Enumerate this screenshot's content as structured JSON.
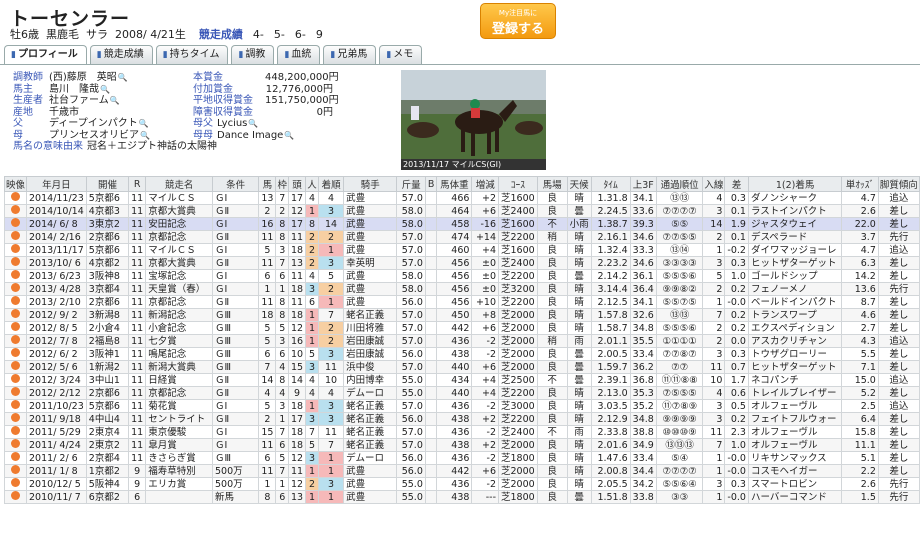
{
  "horse": {
    "name": "トーセンラー",
    "sex_age": "牡6歳",
    "coat": "黒鹿毛",
    "breed": "サラ",
    "birth": "2008/ 4/21生",
    "perf_label": "競走成績",
    "perf": [
      "4-",
      "5-",
      "6-",
      "9"
    ]
  },
  "register_button": {
    "small": "My注目馬に",
    "big": "登録する"
  },
  "tabs": [
    {
      "label": "プロフィール"
    },
    {
      "label": "競走成績"
    },
    {
      "label": "持ちタイム"
    },
    {
      "label": "調教"
    },
    {
      "label": "血統"
    },
    {
      "label": "兄弟馬"
    },
    {
      "label": "メモ"
    }
  ],
  "profile": {
    "left": [
      {
        "label": "調教師",
        "value": "(西)藤原　英昭"
      },
      {
        "label": "馬主",
        "value": "島川　隆哉"
      },
      {
        "label": "生産者",
        "value": "社台ファーム"
      },
      {
        "label": "産地",
        "value": "千歳市"
      },
      {
        "label": "父",
        "value": "ディープインパクト"
      },
      {
        "label": "母",
        "value": "プリンセスオリビア"
      },
      {
        "label": "馬名の意味由来",
        "value": "冠名＋エジプト神話の太陽神"
      }
    ],
    "right": [
      {
        "label": "本賞金",
        "value": "448,200,000円"
      },
      {
        "label": "付加賞金",
        "value": "12,776,000円"
      },
      {
        "label": "平地収得賞金",
        "value": "151,750,000円"
      },
      {
        "label": "障害収得賞金",
        "value": "0円"
      },
      {
        "label": "母父",
        "value": "Lycius"
      },
      {
        "label": "母母",
        "value": "Dance Image"
      }
    ]
  },
  "photo_caption": "2013/11/17 マイルCS(GⅠ)",
  "table": {
    "headers": [
      "映像",
      "年月日",
      "開催",
      "R",
      "競走名",
      "条件",
      "馬",
      "枠",
      "頭",
      "人",
      "着順",
      "騎手",
      "斤量",
      "B",
      "馬体重",
      "増減",
      "ｺｰｽ",
      "馬場",
      "天候",
      "ﾀｲﾑ",
      "上3F",
      "通過順位",
      "入線",
      "差",
      "1(2)着馬",
      "単ｵｯｽﾞ",
      "脚質傾向"
    ],
    "rows": [
      [
        "",
        "2014/11/23",
        "5京都6",
        "11",
        "マイルＣＳ",
        "ＧⅠ",
        "13",
        "7",
        "17",
        "4",
        "4",
        "武豊",
        "57.0",
        "",
        "466",
        "+2",
        "芝1600",
        "良",
        "晴",
        "1.31.8",
        "34.1",
        "⑬⑬",
        "4",
        "0.3",
        "ダノンシャーク",
        "4.7",
        "追込"
      ],
      [
        "",
        "2014/10/14",
        "4京都3",
        "11",
        "京都大賞典",
        "ＧⅡ",
        "2",
        "2",
        "12",
        "1",
        "3",
        "武豊",
        "58.0",
        "",
        "464",
        "+6",
        "芝2400",
        "良",
        "曇",
        "2.24.5",
        "33.6",
        "⑦⑦⑦⑦",
        "3",
        "0.1",
        "ラストインパクト",
        "2.6",
        "差し"
      ],
      [
        "",
        "2014/ 6/ 8",
        "3東京2",
        "11",
        "安田記念",
        "ＧⅠ",
        "16",
        "8",
        "17",
        "8",
        "14",
        "武豊",
        "58.0",
        "",
        "458",
        "-16",
        "芝1600",
        "不",
        "小雨",
        "1.38.7",
        "39.3",
        "⑤⑤",
        "14",
        "1.9",
        "ジャスタウェイ",
        "22.0",
        "差し"
      ],
      [
        "",
        "2014/ 2/16",
        "2京都6",
        "11",
        "京都記念",
        "ＧⅡ",
        "11",
        "8",
        "11",
        "2",
        "2",
        "武豊",
        "57.0",
        "",
        "474",
        "+14",
        "芝2200",
        "稍",
        "晴",
        "2.16.1",
        "34.6",
        "⑦⑦⑤⑤",
        "2",
        "0.1",
        "デスペラード",
        "3.7",
        "先行"
      ],
      [
        "",
        "2013/11/17",
        "5京都6",
        "11",
        "マイルＣＳ",
        "ＧⅠ",
        "5",
        "3",
        "18",
        "2",
        "1",
        "武豊",
        "57.0",
        "",
        "460",
        "+4",
        "芝1600",
        "良",
        "晴",
        "1.32.4",
        "33.3",
        "⑬⑭",
        "1",
        "-0.2",
        "ダイワマッジョーレ",
        "4.7",
        "追込"
      ],
      [
        "",
        "2013/10/ 6",
        "4京都2",
        "11",
        "京都大賞典",
        "ＧⅡ",
        "11",
        "7",
        "13",
        "2",
        "3",
        "幸英明",
        "57.0",
        "",
        "456",
        "±0",
        "芝2400",
        "良",
        "晴",
        "2.23.2",
        "34.6",
        "③③③③",
        "3",
        "0.3",
        "ヒットザターゲット",
        "6.3",
        "差し"
      ],
      [
        "",
        "2013/ 6/23",
        "3阪神8",
        "11",
        "宝塚記念",
        "ＧⅠ",
        "6",
        "6",
        "11",
        "4",
        "5",
        "武豊",
        "58.0",
        "",
        "456",
        "±0",
        "芝2200",
        "良",
        "曇",
        "2.14.2",
        "36.1",
        "⑤⑤⑤⑥",
        "5",
        "1.0",
        "ゴールドシップ",
        "14.2",
        "差し"
      ],
      [
        "",
        "2013/ 4/28",
        "3京都4",
        "11",
        "天皇賞（春）",
        "ＧⅠ",
        "1",
        "1",
        "18",
        "3",
        "2",
        "武豊",
        "58.0",
        "",
        "456",
        "±0",
        "芝3200",
        "良",
        "晴",
        "3.14.4",
        "36.4",
        "⑨⑨⑧②",
        "2",
        "0.2",
        "フェノーメノ",
        "13.6",
        "先行"
      ],
      [
        "",
        "2013/ 2/10",
        "2京都6",
        "11",
        "京都記念",
        "ＧⅡ",
        "11",
        "8",
        "11",
        "6",
        "1",
        "武豊",
        "56.0",
        "",
        "456",
        "+10",
        "芝2200",
        "良",
        "晴",
        "2.12.5",
        "34.1",
        "⑤⑤⑦⑤",
        "1",
        "-0.0",
        "ベールドインパクト",
        "8.7",
        "差し"
      ],
      [
        "",
        "2012/ 9/ 2",
        "3新潟8",
        "11",
        "新潟記念",
        "ＧⅢ",
        "18",
        "8",
        "18",
        "1",
        "7",
        "蛯名正義",
        "57.0",
        "",
        "450",
        "+8",
        "芝2000",
        "良",
        "晴",
        "1.57.8",
        "32.6",
        "⑬⑬",
        "7",
        "0.2",
        "トランスワープ",
        "4.6",
        "差し"
      ],
      [
        "",
        "2012/ 8/ 5",
        "2小倉4",
        "11",
        "小倉記念",
        "ＧⅢ",
        "5",
        "5",
        "12",
        "1",
        "2",
        "川田将雅",
        "57.0",
        "",
        "442",
        "+6",
        "芝2000",
        "良",
        "晴",
        "1.58.7",
        "34.8",
        "⑤⑤⑤⑥",
        "2",
        "0.2",
        "エクスペディション",
        "2.7",
        "差し"
      ],
      [
        "",
        "2012/ 7/ 8",
        "2福島8",
        "11",
        "七夕賞",
        "ＧⅢ",
        "5",
        "3",
        "16",
        "1",
        "2",
        "岩田康誠",
        "57.0",
        "",
        "436",
        "-2",
        "芝2000",
        "稍",
        "雨",
        "2.01.1",
        "35.5",
        "①①①①",
        "2",
        "0.0",
        "アスカクリチャン",
        "4.3",
        "追込"
      ],
      [
        "",
        "2012/ 6/ 2",
        "3阪神1",
        "11",
        "鳴尾記念",
        "ＧⅢ",
        "6",
        "6",
        "10",
        "5",
        "3",
        "岩田康誠",
        "56.0",
        "",
        "438",
        "-2",
        "芝2000",
        "良",
        "曇",
        "2.00.5",
        "33.4",
        "⑦⑦⑧⑦",
        "3",
        "0.3",
        "トウザグローリー",
        "5.5",
        "差し"
      ],
      [
        "",
        "2012/ 5/ 6",
        "1新潟2",
        "11",
        "新潟大賞典",
        "ＧⅢ",
        "7",
        "4",
        "15",
        "3",
        "11",
        "浜中俊",
        "57.0",
        "",
        "440",
        "+6",
        "芝2000",
        "良",
        "曇",
        "1.59.7",
        "36.2",
        "⑦⑦",
        "11",
        "0.7",
        "ヒットザターゲット",
        "7.1",
        "差し"
      ],
      [
        "",
        "2012/ 3/24",
        "3中山1",
        "11",
        "日経賞",
        "ＧⅡ",
        "14",
        "8",
        "14",
        "4",
        "10",
        "内田博幸",
        "55.0",
        "",
        "434",
        "+4",
        "芝2500",
        "不",
        "曇",
        "2.39.1",
        "36.8",
        "⑪⑪⑧⑧",
        "10",
        "1.7",
        "ネコパンチ",
        "15.0",
        "追込"
      ],
      [
        "",
        "2012/ 2/12",
        "2京都6",
        "11",
        "京都記念",
        "ＧⅡ",
        "4",
        "4",
        "9",
        "4",
        "4",
        "デムーロ",
        "55.0",
        "",
        "440",
        "+4",
        "芝2200",
        "良",
        "晴",
        "2.13.0",
        "35.3",
        "⑦⑤⑤⑤",
        "4",
        "0.6",
        "トレイルブレイザー",
        "5.2",
        "差し"
      ],
      [
        "",
        "2011/10/23",
        "5京都6",
        "11",
        "菊花賞",
        "ＧⅠ",
        "5",
        "3",
        "18",
        "1",
        "3",
        "蛯名正義",
        "57.0",
        "",
        "436",
        "-2",
        "芝3000",
        "良",
        "晴",
        "3.03.5",
        "35.2",
        "⑪⑦⑧⑨",
        "3",
        "0.5",
        "オルフェーヴル",
        "2.5",
        "追込"
      ],
      [
        "",
        "2011/ 9/18",
        "4中山4",
        "11",
        "セントライト",
        "ＧⅡ",
        "2",
        "1",
        "17",
        "3",
        "3",
        "蛯名正義",
        "56.0",
        "",
        "438",
        "+2",
        "芝2200",
        "良",
        "晴",
        "2.12.9",
        "34.8",
        "⑨⑨⑨⑨",
        "3",
        "0.2",
        "フェイトフルウォー",
        "6.4",
        "差し"
      ],
      [
        "",
        "2011/ 5/29",
        "2東京4",
        "11",
        "東京優駿",
        "ＧⅠ",
        "15",
        "7",
        "18",
        "7",
        "11",
        "蛯名正義",
        "57.0",
        "",
        "436",
        "-2",
        "芝2400",
        "不",
        "雨",
        "2.33.8",
        "38.8",
        "⑩⑩⑩⑨",
        "11",
        "2.3",
        "オルフェーヴル",
        "15.8",
        "差し"
      ],
      [
        "",
        "2011/ 4/24",
        "2東京2",
        "11",
        "皐月賞",
        "ＧⅠ",
        "11",
        "6",
        "18",
        "5",
        "7",
        "蛯名正義",
        "57.0",
        "",
        "438",
        "+2",
        "芝2000",
        "良",
        "晴",
        "2.01.6",
        "34.9",
        "⑬⑬⑬",
        "7",
        "1.0",
        "オルフェーヴル",
        "11.1",
        "差し"
      ],
      [
        "",
        "2011/ 2/ 6",
        "2京都4",
        "11",
        "きさらぎ賞",
        "ＧⅢ",
        "6",
        "5",
        "12",
        "3",
        "1",
        "デムーロ",
        "56.0",
        "",
        "436",
        "-2",
        "芝1800",
        "良",
        "晴",
        "1.47.6",
        "33.4",
        "⑤④",
        "1",
        "-0.0",
        "リキサンマックス",
        "5.1",
        "差し"
      ],
      [
        "",
        "2011/ 1/ 8",
        "1京都2",
        "9",
        "福寿草特別",
        "500万",
        "11",
        "7",
        "11",
        "1",
        "1",
        "武豊",
        "56.0",
        "",
        "442",
        "+6",
        "芝2000",
        "良",
        "晴",
        "2.00.8",
        "34.4",
        "⑦⑦⑦⑦",
        "1",
        "-0.0",
        "コスモヘイガー",
        "2.2",
        "差し"
      ],
      [
        "",
        "2010/12/ 5",
        "5阪神4",
        "9",
        "エリカ賞",
        "500万",
        "1",
        "1",
        "12",
        "2",
        "3",
        "武豊",
        "55.0",
        "",
        "436",
        "-2",
        "芝2000",
        "良",
        "晴",
        "2.05.5",
        "34.2",
        "⑤⑤⑥④",
        "3",
        "0.3",
        "スマートロビン",
        "2.6",
        "先行"
      ],
      [
        "",
        "2010/11/ 7",
        "6京都2",
        "6",
        "",
        "新馬",
        "8",
        "6",
        "13",
        "1",
        "1",
        "武豊",
        "55.0",
        "",
        "438",
        "---",
        "芝1800",
        "良",
        "曇",
        "1.51.8",
        "33.8",
        "③③",
        "1",
        "-0.0",
        "ハーバーコマンド",
        "1.5",
        "先行"
      ]
    ]
  }
}
